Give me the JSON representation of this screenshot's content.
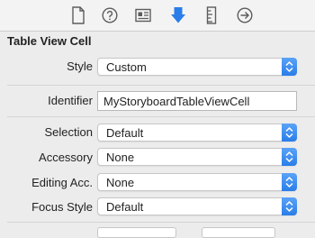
{
  "toolbar": {
    "icons": [
      "file-inspector-icon",
      "help-icon",
      "identity-inspector-icon",
      "attributes-inspector-icon",
      "size-inspector-icon",
      "connections-inspector-icon"
    ],
    "accent": "#2a7de9"
  },
  "section": {
    "title": "Table View Cell"
  },
  "fields": {
    "style": {
      "label": "Style",
      "value": "Custom"
    },
    "identifier": {
      "label": "Identifier",
      "value": "MyStoryboardTableViewCell"
    },
    "selection": {
      "label": "Selection",
      "value": "Default"
    },
    "accessory": {
      "label": "Accessory",
      "value": "None"
    },
    "editing_accessory": {
      "label": "Editing Acc.",
      "value": "None"
    },
    "focus_style": {
      "label": "Focus Style",
      "value": "Default"
    }
  }
}
